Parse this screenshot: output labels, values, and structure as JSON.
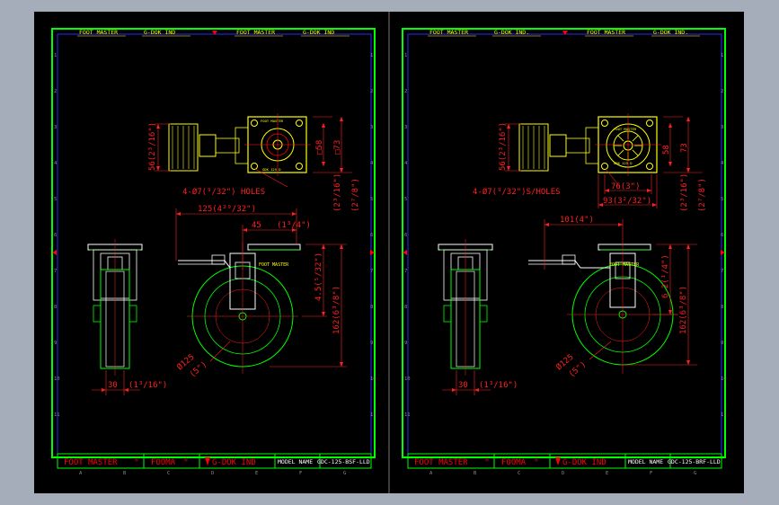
{
  "colors": {
    "background": "#000000",
    "frame": "#00ff00",
    "inner": "#2a2aff",
    "dim": "#ff2020",
    "text": "#ffff00",
    "part": "#ffffff",
    "marker": "#ff0000",
    "chrome": "#a4adb9"
  },
  "header": {
    "brand": "FOOT MASTER",
    "company": "G-DOK IND"
  },
  "header_b": {
    "company": "G-DOK IND."
  },
  "row_numbers": [
    "1",
    "2",
    "3",
    "4",
    "5",
    "6",
    "7",
    "8",
    "9",
    "10",
    "11"
  ],
  "column_letters": [
    "A",
    "B",
    "C",
    "D",
    "E",
    "F",
    "G"
  ],
  "titleblock": {
    "brand": "FOOT MASTER",
    "brand2": "FOOMA",
    "registered": "®",
    "company": "G-DOK IND",
    "model_label": "MODEL  NAME"
  },
  "sheets": [
    {
      "model_name": "GDC-125-BSF-LLD",
      "plate": {
        "brand": "FOOT MASTER",
        "model": "GDK 125 D",
        "label": "FOOT MASTER"
      },
      "dims": {
        "offset_56": "56(2³/16\")",
        "plate_58": "□58",
        "plate_73": "□73",
        "hole_spec": "4-Ø7(⁹/32\") HOLES",
        "frac_a": "(2³/16\")",
        "frac_b": "(2⁷/8\")",
        "width_125": "125(4²⁹/32\")",
        "off_45": "45",
        "off_45_in": "(1³/4\")",
        "ecc": "4.5(⁵/32\")",
        "height": "162(6³/8\")",
        "wheel_d": "Ø125",
        "wheel_d_in": "(5\")",
        "tread": "30",
        "tread_in": "(1³/16\")"
      }
    },
    {
      "model_name": "GDC-125-BRF-LLD",
      "plate": {
        "brand": "FOOT MASTER",
        "model": "GDK 125 D",
        "label": "FOOT MASTER"
      },
      "dims": {
        "offset_56": "56(2³/16\")",
        "plate_58": "58",
        "plate_73": "73",
        "hole_spec": "4-Ø7(⁹/32\")S/HOLES",
        "frac_a": "(2³/16\")",
        "frac_b": "(2⁷/8\")",
        "b_76": "76(3\")",
        "b_93": "93(3²/32\")",
        "width_101": "101(4\")",
        "ecc": "6.2(¹/4\")",
        "height": "162(6³/8\")",
        "wheel_d": "Ø125",
        "wheel_d_in": "(5\")",
        "tread": "30",
        "tread_in": "(1³/16\")"
      }
    }
  ]
}
